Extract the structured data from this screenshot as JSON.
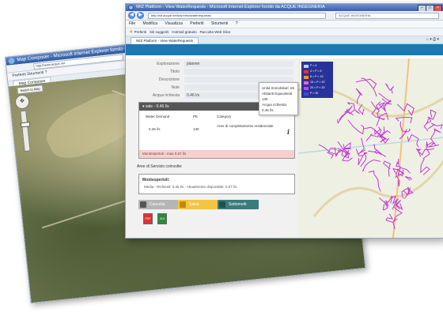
{
  "back_window": {
    "title": "Map Composer - Microsoft Internet Explorer fornito da ACQUE INGEGNERIA",
    "address": "http://www.acque.net",
    "menu": "Preferiti   Strumenti   ?",
    "favorites": "Preferiti",
    "tab_label": "Map Composer",
    "map_button_label": "Switch to Map"
  },
  "front_window": {
    "title": "WIZ Platform - View WaterRequests - Microsoft Internet Explorer fornito da ACQUE INGEGNERIA",
    "address": "http://sit.acque.net/wiz/view/waterrequests/",
    "search_placeholder": "ACQUE INGEGNERIA",
    "menu": [
      "File",
      "Modifica",
      "Visualizza",
      "Preferiti",
      "Strumenti",
      "?"
    ],
    "favorites_label": "Preferiti",
    "favorites_items": [
      "Siti suggeriti",
      "Hotmail gratuito",
      "Raccolta Web Slice"
    ],
    "tab_label": "WIZ Platform - View WaterRequests",
    "tab_tools": "⌂ ▾ ⎙ ▾"
  },
  "form": {
    "rows": [
      {
        "label": "Esplorazione",
        "value": "planner"
      },
      {
        "label": "Titolo",
        "value": ""
      },
      {
        "label": "Descrizione",
        "value": ""
      },
      {
        "label": "Note",
        "value": ""
      },
      {
        "label": "Acqua richiesta",
        "value": "0.46 l/s"
      }
    ],
    "panel": {
      "header": "▾ sale - 0.46 l/s",
      "columns": [
        "Water Demand",
        "PE",
        "Category"
      ],
      "values": [
        "0.46 l/s",
        "130",
        "Aree di completamento residenziale"
      ],
      "footer": "Montespertoli - max 0.57 l/s"
    },
    "areas_label": "Aree di Servizio coinvolte:",
    "area": {
      "title": "Montespertoli:",
      "detail": "Media - Richiesti: 0.46 l/s - Attualmente disponibile: 0.57 l/s"
    },
    "buttons": {
      "delete": "Cancella",
      "save": "Salva",
      "submit": "Sottometti"
    },
    "export_pdf": "PDF",
    "export_xls": "XLS"
  },
  "tooltip": {
    "line1": "Unità Immobiliari: 65",
    "line2": "Abitanti Equivalenti: 130",
    "line3": "Acqua richiesta: 0.46 l/s"
  },
  "legend": [
    {
      "label": "P < 4",
      "color": "#c8cde8"
    },
    {
      "label": "4 < P < 8",
      "color": "#ff2c2c"
    },
    {
      "label": "8 < P < 15",
      "color": "#ff8a3c"
    },
    {
      "label": "15 < P < 20",
      "color": "#ff5fd0"
    },
    {
      "label": "20 < P < 30",
      "color": "#b04dff"
    },
    {
      "label": "P > 30",
      "color": "#3f4ad6"
    }
  ],
  "colors": {
    "app_header": "#1a78b4",
    "legend_bg": "#28339a",
    "network_lines": "#c33bd0"
  }
}
